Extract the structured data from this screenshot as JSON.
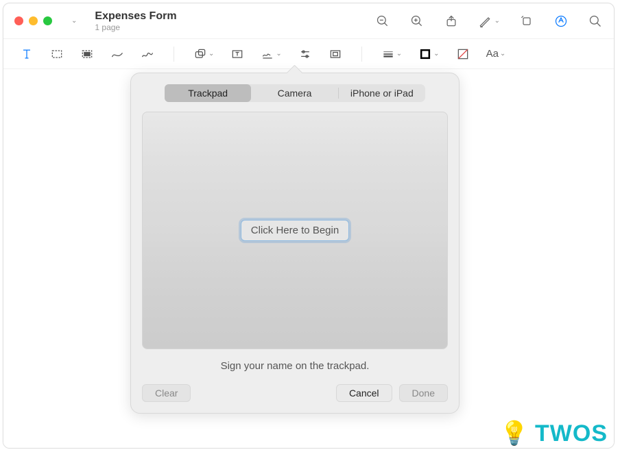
{
  "window": {
    "title": "Expenses Form",
    "subtitle": "1 page"
  },
  "toolbar2": {
    "text_style_label": "Aa"
  },
  "popover": {
    "tabs": {
      "trackpad": "Trackpad",
      "camera": "Camera",
      "iphone": "iPhone or iPad"
    },
    "begin_label": "Click Here to Begin",
    "hint": "Sign your name on the trackpad.",
    "buttons": {
      "clear": "Clear",
      "cancel": "Cancel",
      "done": "Done"
    }
  },
  "watermark": {
    "text": "TWOS"
  }
}
